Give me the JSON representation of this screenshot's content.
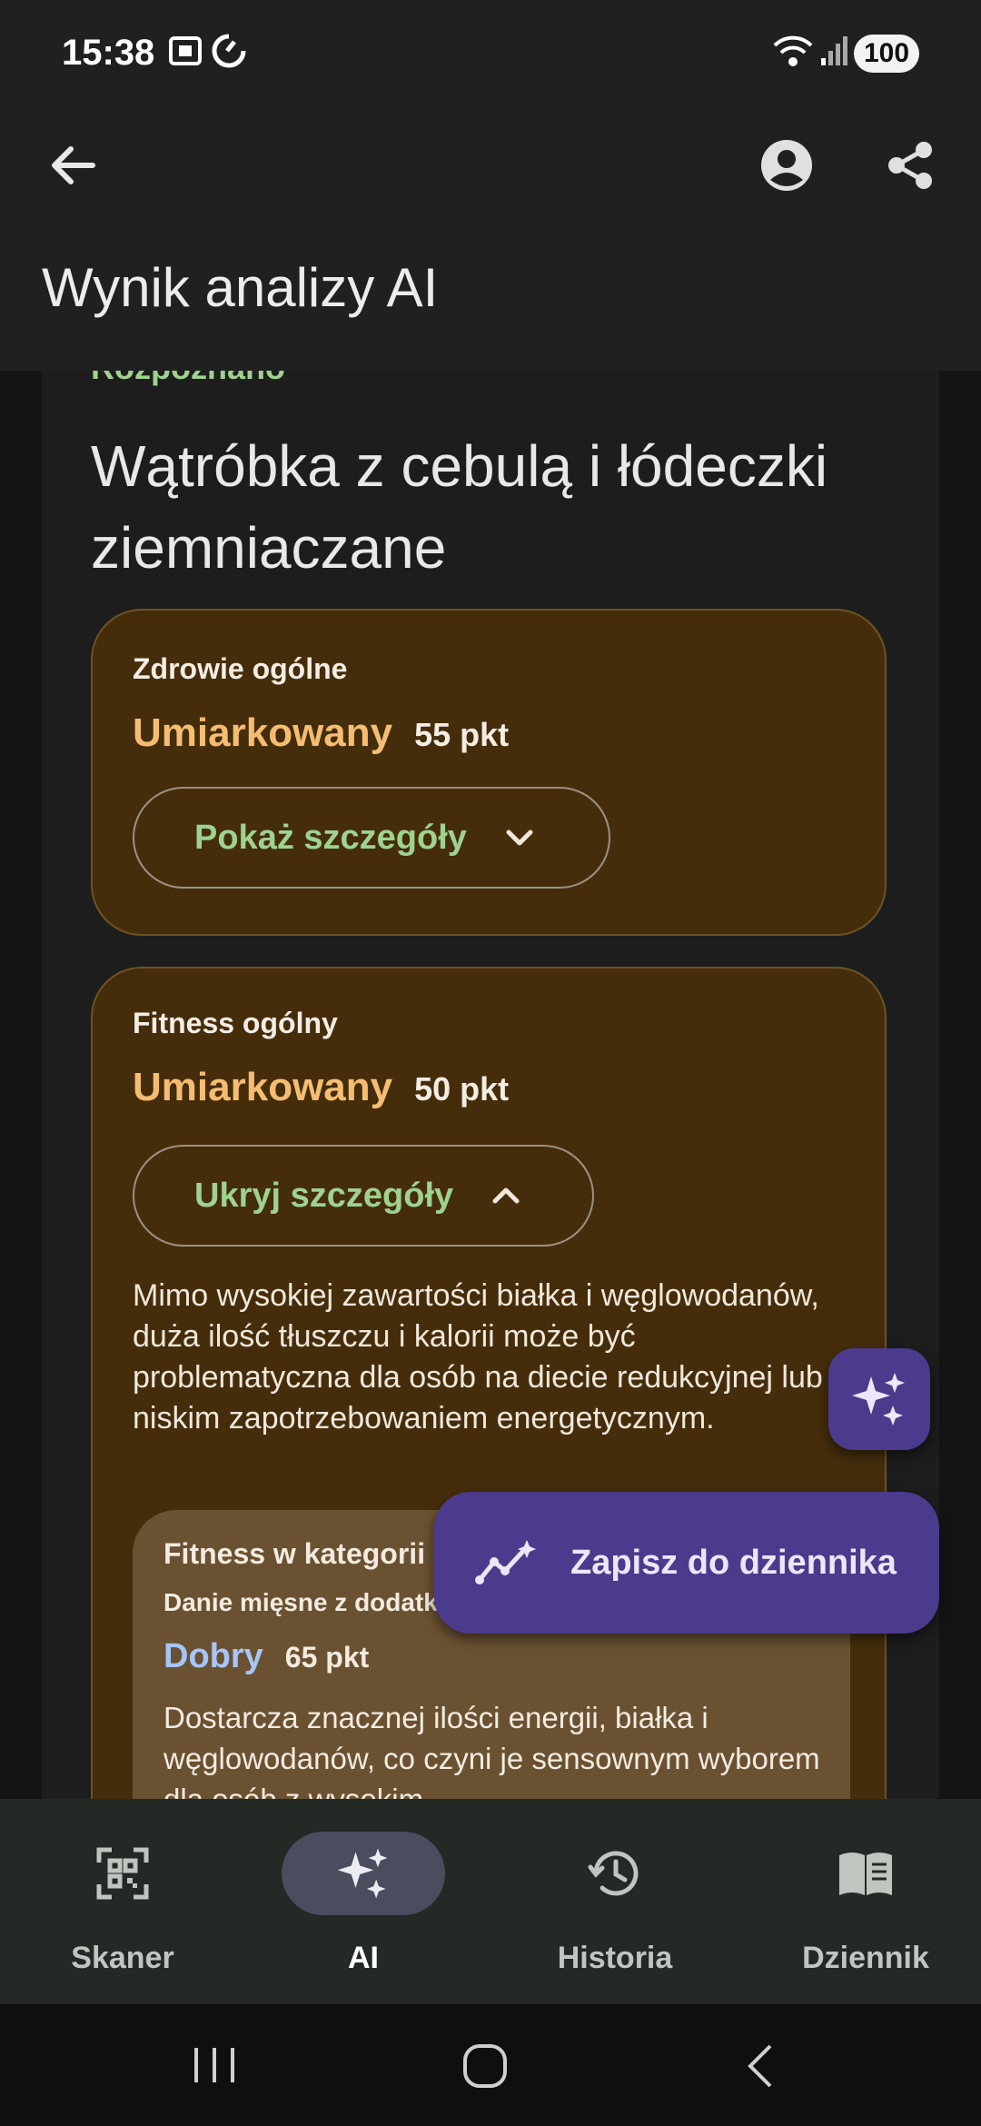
{
  "status_bar": {
    "time": "15:38",
    "battery": "100"
  },
  "app_bar": {
    "title": "Wynik analizy AI"
  },
  "analysis": {
    "recognized_label": "Rozpoznano",
    "dish_name": "Wątróbka z cebulą i łódeczki ziemniaczane"
  },
  "health_card": {
    "label": "Zdrowie ogólne",
    "rating": "Umiarkowany",
    "points": "55 pkt",
    "toggle_label": "Pokaż szczegóły"
  },
  "fitness_card": {
    "label": "Fitness ogólny",
    "rating": "Umiarkowany",
    "points": "50 pkt",
    "toggle_label": "Ukryj szczegóły",
    "description": "Mimo wysokiej zawartości białka i węglowodanów, duża ilość tłuszczu i kalorii może być problematyczna dla osób na diecie redukcyjnej lub z niskim zapotrzebowaniem energetycznym.",
    "category": {
      "title": "Fitness w kategorii",
      "subtitle": "Danie mięsne z dodatkami",
      "rating": "Dobry",
      "points": "65 pkt",
      "description": "Dostarcza znacznej ilości energii, białka i węglowodanów, co czyni je sensownym wyborem dla osób z wysokim"
    }
  },
  "fab": {
    "save_label": "Zapisz do dziennika"
  },
  "bottom_nav": {
    "items": [
      {
        "label": "Skaner",
        "icon": "qr-scanner-icon"
      },
      {
        "label": "AI",
        "icon": "sparkles-icon"
      },
      {
        "label": "Historia",
        "icon": "history-icon"
      },
      {
        "label": "Dziennik",
        "icon": "book-icon"
      }
    ],
    "active": "AI"
  },
  "colors": {
    "card_bg": "#452d0c",
    "rating_orange": "#f5bd72",
    "toggle_green": "#9ed28f",
    "rating_blue": "#a7c5f7",
    "fab_purple": "#4c3a8c"
  }
}
